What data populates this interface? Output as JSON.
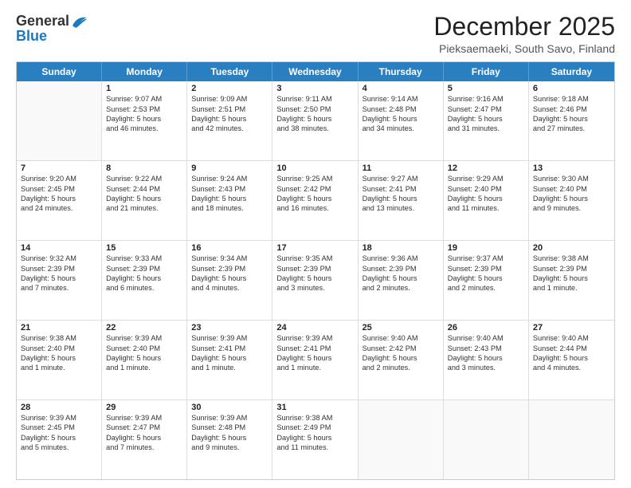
{
  "header": {
    "logo_general": "General",
    "logo_blue": "Blue",
    "month_title": "December 2025",
    "subtitle": "Pieksaemaeki, South Savo, Finland"
  },
  "days_of_week": [
    "Sunday",
    "Monday",
    "Tuesday",
    "Wednesday",
    "Thursday",
    "Friday",
    "Saturday"
  ],
  "weeks": [
    [
      {
        "day": "",
        "lines": []
      },
      {
        "day": "1",
        "lines": [
          "Sunrise: 9:07 AM",
          "Sunset: 2:53 PM",
          "Daylight: 5 hours",
          "and 46 minutes."
        ]
      },
      {
        "day": "2",
        "lines": [
          "Sunrise: 9:09 AM",
          "Sunset: 2:51 PM",
          "Daylight: 5 hours",
          "and 42 minutes."
        ]
      },
      {
        "day": "3",
        "lines": [
          "Sunrise: 9:11 AM",
          "Sunset: 2:50 PM",
          "Daylight: 5 hours",
          "and 38 minutes."
        ]
      },
      {
        "day": "4",
        "lines": [
          "Sunrise: 9:14 AM",
          "Sunset: 2:48 PM",
          "Daylight: 5 hours",
          "and 34 minutes."
        ]
      },
      {
        "day": "5",
        "lines": [
          "Sunrise: 9:16 AM",
          "Sunset: 2:47 PM",
          "Daylight: 5 hours",
          "and 31 minutes."
        ]
      },
      {
        "day": "6",
        "lines": [
          "Sunrise: 9:18 AM",
          "Sunset: 2:46 PM",
          "Daylight: 5 hours",
          "and 27 minutes."
        ]
      }
    ],
    [
      {
        "day": "7",
        "lines": [
          "Sunrise: 9:20 AM",
          "Sunset: 2:45 PM",
          "Daylight: 5 hours",
          "and 24 minutes."
        ]
      },
      {
        "day": "8",
        "lines": [
          "Sunrise: 9:22 AM",
          "Sunset: 2:44 PM",
          "Daylight: 5 hours",
          "and 21 minutes."
        ]
      },
      {
        "day": "9",
        "lines": [
          "Sunrise: 9:24 AM",
          "Sunset: 2:43 PM",
          "Daylight: 5 hours",
          "and 18 minutes."
        ]
      },
      {
        "day": "10",
        "lines": [
          "Sunrise: 9:25 AM",
          "Sunset: 2:42 PM",
          "Daylight: 5 hours",
          "and 16 minutes."
        ]
      },
      {
        "day": "11",
        "lines": [
          "Sunrise: 9:27 AM",
          "Sunset: 2:41 PM",
          "Daylight: 5 hours",
          "and 13 minutes."
        ]
      },
      {
        "day": "12",
        "lines": [
          "Sunrise: 9:29 AM",
          "Sunset: 2:40 PM",
          "Daylight: 5 hours",
          "and 11 minutes."
        ]
      },
      {
        "day": "13",
        "lines": [
          "Sunrise: 9:30 AM",
          "Sunset: 2:40 PM",
          "Daylight: 5 hours",
          "and 9 minutes."
        ]
      }
    ],
    [
      {
        "day": "14",
        "lines": [
          "Sunrise: 9:32 AM",
          "Sunset: 2:39 PM",
          "Daylight: 5 hours",
          "and 7 minutes."
        ]
      },
      {
        "day": "15",
        "lines": [
          "Sunrise: 9:33 AM",
          "Sunset: 2:39 PM",
          "Daylight: 5 hours",
          "and 6 minutes."
        ]
      },
      {
        "day": "16",
        "lines": [
          "Sunrise: 9:34 AM",
          "Sunset: 2:39 PM",
          "Daylight: 5 hours",
          "and 4 minutes."
        ]
      },
      {
        "day": "17",
        "lines": [
          "Sunrise: 9:35 AM",
          "Sunset: 2:39 PM",
          "Daylight: 5 hours",
          "and 3 minutes."
        ]
      },
      {
        "day": "18",
        "lines": [
          "Sunrise: 9:36 AM",
          "Sunset: 2:39 PM",
          "Daylight: 5 hours",
          "and 2 minutes."
        ]
      },
      {
        "day": "19",
        "lines": [
          "Sunrise: 9:37 AM",
          "Sunset: 2:39 PM",
          "Daylight: 5 hours",
          "and 2 minutes."
        ]
      },
      {
        "day": "20",
        "lines": [
          "Sunrise: 9:38 AM",
          "Sunset: 2:39 PM",
          "Daylight: 5 hours",
          "and 1 minute."
        ]
      }
    ],
    [
      {
        "day": "21",
        "lines": [
          "Sunrise: 9:38 AM",
          "Sunset: 2:40 PM",
          "Daylight: 5 hours",
          "and 1 minute."
        ]
      },
      {
        "day": "22",
        "lines": [
          "Sunrise: 9:39 AM",
          "Sunset: 2:40 PM",
          "Daylight: 5 hours",
          "and 1 minute."
        ]
      },
      {
        "day": "23",
        "lines": [
          "Sunrise: 9:39 AM",
          "Sunset: 2:41 PM",
          "Daylight: 5 hours",
          "and 1 minute."
        ]
      },
      {
        "day": "24",
        "lines": [
          "Sunrise: 9:39 AM",
          "Sunset: 2:41 PM",
          "Daylight: 5 hours",
          "and 1 minute."
        ]
      },
      {
        "day": "25",
        "lines": [
          "Sunrise: 9:40 AM",
          "Sunset: 2:42 PM",
          "Daylight: 5 hours",
          "and 2 minutes."
        ]
      },
      {
        "day": "26",
        "lines": [
          "Sunrise: 9:40 AM",
          "Sunset: 2:43 PM",
          "Daylight: 5 hours",
          "and 3 minutes."
        ]
      },
      {
        "day": "27",
        "lines": [
          "Sunrise: 9:40 AM",
          "Sunset: 2:44 PM",
          "Daylight: 5 hours",
          "and 4 minutes."
        ]
      }
    ],
    [
      {
        "day": "28",
        "lines": [
          "Sunrise: 9:39 AM",
          "Sunset: 2:45 PM",
          "Daylight: 5 hours",
          "and 5 minutes."
        ]
      },
      {
        "day": "29",
        "lines": [
          "Sunrise: 9:39 AM",
          "Sunset: 2:47 PM",
          "Daylight: 5 hours",
          "and 7 minutes."
        ]
      },
      {
        "day": "30",
        "lines": [
          "Sunrise: 9:39 AM",
          "Sunset: 2:48 PM",
          "Daylight: 5 hours",
          "and 9 minutes."
        ]
      },
      {
        "day": "31",
        "lines": [
          "Sunrise: 9:38 AM",
          "Sunset: 2:49 PM",
          "Daylight: 5 hours",
          "and 11 minutes."
        ]
      },
      {
        "day": "",
        "lines": []
      },
      {
        "day": "",
        "lines": []
      },
      {
        "day": "",
        "lines": []
      }
    ]
  ]
}
